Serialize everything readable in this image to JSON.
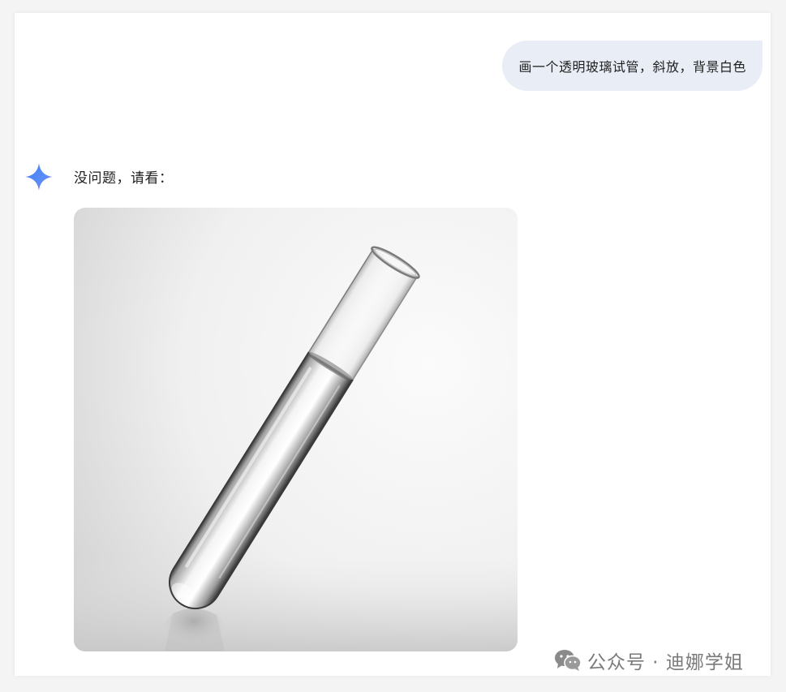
{
  "user_message": {
    "text": "画一个透明玻璃试管，斜放，背景白色"
  },
  "assistant_message": {
    "icon": "sparkle-icon",
    "text": "没问题，请看："
  },
  "generated_image": {
    "subject": "glass-test-tube"
  },
  "watermark": {
    "icon": "wechat-icon",
    "text": "公众号 · 迪娜学姐"
  },
  "colors": {
    "user_bubble": "#e9eef6",
    "sparkle_start": "#4e8cf7",
    "sparkle_end": "#7b5cf0",
    "watermark": "#7a7a7a"
  }
}
